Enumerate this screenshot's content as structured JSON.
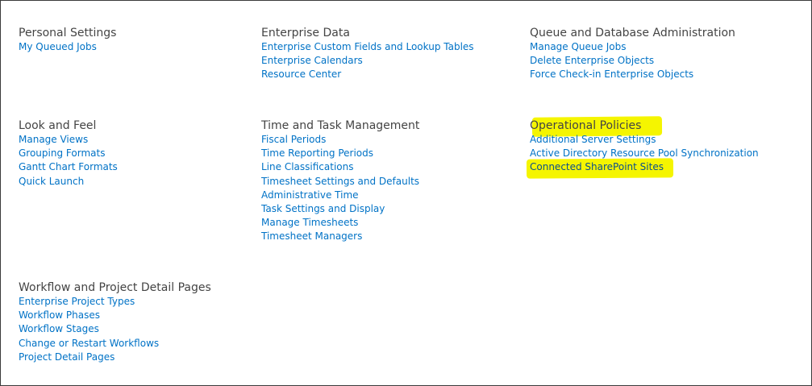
{
  "sections": {
    "personal": {
      "title": "Personal Settings",
      "links": [
        "My Queued Jobs"
      ]
    },
    "enterprise": {
      "title": "Enterprise Data",
      "links": [
        "Enterprise Custom Fields and Lookup Tables",
        "Enterprise Calendars",
        "Resource Center"
      ]
    },
    "queue": {
      "title": "Queue and Database Administration",
      "links": [
        "Manage Queue Jobs",
        "Delete Enterprise Objects",
        "Force Check-in Enterprise Objects"
      ]
    },
    "look": {
      "title": "Look and Feel",
      "links": [
        "Manage Views",
        "Grouping Formats",
        "Gantt Chart Formats",
        "Quick Launch"
      ]
    },
    "time": {
      "title": "Time and Task Management",
      "links": [
        "Fiscal Periods",
        "Time Reporting Periods",
        "Line Classifications",
        "Timesheet Settings and Defaults",
        "Administrative Time",
        "Task Settings and Display",
        "Manage Timesheets",
        "Timesheet Managers"
      ]
    },
    "ops": {
      "title": "Operational Policies",
      "links": [
        "Additional Server Settings",
        "Active Directory Resource Pool Synchronization",
        "Connected SharePoint Sites"
      ]
    },
    "workflow": {
      "title": "Workflow and Project Detail Pages",
      "links": [
        "Enterprise Project Types",
        "Workflow Phases",
        "Workflow Stages",
        "Change or Restart Workflows",
        "Project Detail Pages"
      ]
    }
  },
  "highlight_color": "#f5f500",
  "link_color": "#0072c6",
  "title_color": "#444444"
}
